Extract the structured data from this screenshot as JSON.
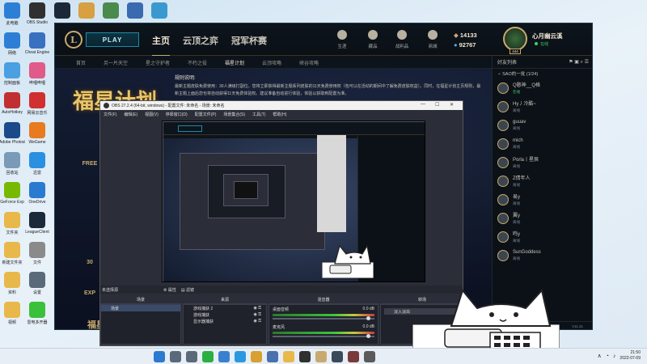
{
  "desktop": {
    "icons_col1": [
      {
        "label": "此电脑",
        "icon": "computer-icon",
        "color": "#2d7fd6"
      },
      {
        "label": "网络",
        "icon": "network-icon",
        "color": "#2d7fd6"
      },
      {
        "label": "控制面板",
        "icon": "control-panel-icon",
        "color": "#4aa0e0"
      },
      {
        "label": "AutoHotkey",
        "icon": "script-icon",
        "color": "#c03030"
      },
      {
        "label": "Adobe Photoshop",
        "icon": "photoshop-icon",
        "color": "#1a4a8a"
      },
      {
        "label": "回收站",
        "icon": "recycle-bin-icon",
        "color": "#7a9ab8"
      },
      {
        "label": "GeForce Exp",
        "icon": "nvidia-icon",
        "color": "#76b900"
      },
      {
        "label": "文件夹",
        "icon": "folder-icon",
        "color": "#e8b84a"
      },
      {
        "label": "新建文件夹",
        "icon": "folder-icon",
        "color": "#e8b84a"
      },
      {
        "label": "资料",
        "icon": "folder-icon",
        "color": "#e8b84a"
      },
      {
        "label": "视频",
        "icon": "folder-icon",
        "color": "#e8b84a"
      }
    ],
    "icons_col2": [
      {
        "label": "OBS Studio",
        "icon": "obs-icon",
        "color": "#303030"
      },
      {
        "label": "Cheat Engine",
        "icon": "app-icon",
        "color": "#3a70c0"
      },
      {
        "label": "哔哩哔哩",
        "icon": "bilibili-icon",
        "color": "#e05a8a"
      },
      {
        "label": "网易云音乐",
        "icon": "music-icon",
        "color": "#d03030"
      },
      {
        "label": "WeGame",
        "icon": "wegame-icon",
        "color": "#e87a20"
      },
      {
        "label": "迅雷",
        "icon": "download-icon",
        "color": "#2a90e0"
      },
      {
        "label": "OneDrive",
        "icon": "cloud-icon",
        "color": "#2a7ad0"
      },
      {
        "label": "LeagueClient",
        "icon": "league-icon",
        "color": "#1a2a3a"
      },
      {
        "label": "文件",
        "icon": "file-icon",
        "color": "#8a8a8a"
      },
      {
        "label": "设置",
        "icon": "gear-icon",
        "color": "#5a6a7a"
      },
      {
        "label": "雷电多开器",
        "icon": "emulator-icon",
        "color": "#3ac03a"
      }
    ],
    "icons_top": [
      {
        "label": "",
        "icon": "steam-icon",
        "color": "#1b2838"
      },
      {
        "label": "",
        "icon": "counter-strike-icon",
        "color": "#d8a040"
      },
      {
        "label": "",
        "icon": "game-icon",
        "color": "#4a8a4a"
      },
      {
        "label": "",
        "icon": "app-icon",
        "color": "#3a6ab0"
      },
      {
        "label": "",
        "icon": "chrome-icon",
        "color": "#3a9ad0"
      }
    ]
  },
  "lol": {
    "play_label": "PLAY",
    "logo_letter": "L",
    "main_tabs": [
      "主页",
      "云顶之弈",
      "冠军杯赛"
    ],
    "top_icons": [
      "生涯",
      "藏品",
      "战利品",
      "商城"
    ],
    "rp": "14133",
    "be": "92767",
    "username": "心月幽云溪",
    "user_status": "在线",
    "level": "444",
    "sub_tabs": [
      "首页",
      "另一片天空",
      "星之守护者",
      "不朽之役",
      "福星计划",
      "云顶攻略",
      "峡谷攻略"
    ],
    "sub_active": 4,
    "banner_title": "福星计划",
    "rules_label": "规则说明:",
    "rules_text": "最新主题皮肤免费使用：30人满级打副位，您将立即获得最新主题系列皮肤的11天免费使用权（包可以在活动的期间中了解免费皮肤权益）。同时，在福星计划主页规则，最新主题上面后您也将自动获得11天免费体验权。建议准备自动进行体验，体验以获取到配置为准。",
    "side_badges": [
      "FREE",
      "30",
      "EXP"
    ],
    "banner_sub": "福星计划",
    "friends_title": "好友列表",
    "friends_group": "SAO的一批 (1/24)",
    "friends": [
      {
        "name": "Q憨神__Q格",
        "status": "在线",
        "online": true
      },
      {
        "name": "Hy丿冷酷~",
        "status": "离线",
        "online": false
      },
      {
        "name": "guuav",
        "status": "离线",
        "online": false
      },
      {
        "name": "mich",
        "status": "离线",
        "online": false
      },
      {
        "name": "Porla丨星辰",
        "status": "离线",
        "online": false
      },
      {
        "name": "Z倩年人",
        "status": "离线",
        "online": false
      },
      {
        "name": "易y",
        "status": "离线",
        "online": false
      },
      {
        "name": "翼y",
        "status": "离线",
        "online": false
      },
      {
        "name": "鸣y",
        "status": "离线",
        "online": false
      },
      {
        "name": "SunGoddess",
        "status": "离线",
        "online": false
      }
    ],
    "friends_footer": "V11.21"
  },
  "obs": {
    "title": "OBS 27.2.4 (64-bit, windows) - 配置文件: 未命名 - 场景: 未命名",
    "menu": [
      "文件(F)",
      "编辑(E)",
      "视图(V)",
      "停靠窗口(D)",
      "配置文件(P)",
      "场景集合(S)",
      "工具(T)",
      "帮助(H)"
    ],
    "status_text": "未选择源",
    "status_btns": [
      "属性",
      "滤镜"
    ],
    "docks": [
      "场景",
      "来源",
      "混音器",
      "转场"
    ],
    "scenes": [
      "场景"
    ],
    "sources": [
      "游戏捕获 2",
      "游戏捕获",
      "显示器捕获"
    ],
    "mixer": [
      {
        "label": "桌面音频",
        "db": "0.0 dB"
      },
      {
        "label": "麦克风",
        "db": "0.0 dB"
      }
    ],
    "transition": "淡入淡出"
  },
  "taskbar": {
    "time": "21:50",
    "date": "2022-07-09",
    "icons": [
      {
        "icon": "windows-icon",
        "color": "#2a7ad0"
      },
      {
        "icon": "search-icon",
        "color": "#5a6a7a"
      },
      {
        "icon": "task-view-icon",
        "color": "#5a6a7a"
      },
      {
        "icon": "wechat-icon",
        "color": "#2ab040"
      },
      {
        "icon": "browser-icon",
        "color": "#3a80d0"
      },
      {
        "icon": "qq-icon",
        "color": "#2a9ae0"
      },
      {
        "icon": "chrome-icon",
        "color": "#d8a030"
      },
      {
        "icon": "app-icon",
        "color": "#4a70b0"
      },
      {
        "icon": "file-explorer-icon",
        "color": "#e8b84a"
      },
      {
        "icon": "obs-icon",
        "color": "#303030"
      },
      {
        "icon": "league-icon",
        "color": "#c8aa6e"
      },
      {
        "icon": "app-icon",
        "color": "#3a4a5a"
      },
      {
        "icon": "app-icon",
        "color": "#7a3a3a"
      },
      {
        "icon": "app-icon",
        "color": "#5a5a5a"
      }
    ]
  },
  "colors": {
    "gold": "#c8aa6e",
    "teal": "#1e8aa3",
    "online": "#3dd36a",
    "obs_bg": "#2b2e38"
  }
}
